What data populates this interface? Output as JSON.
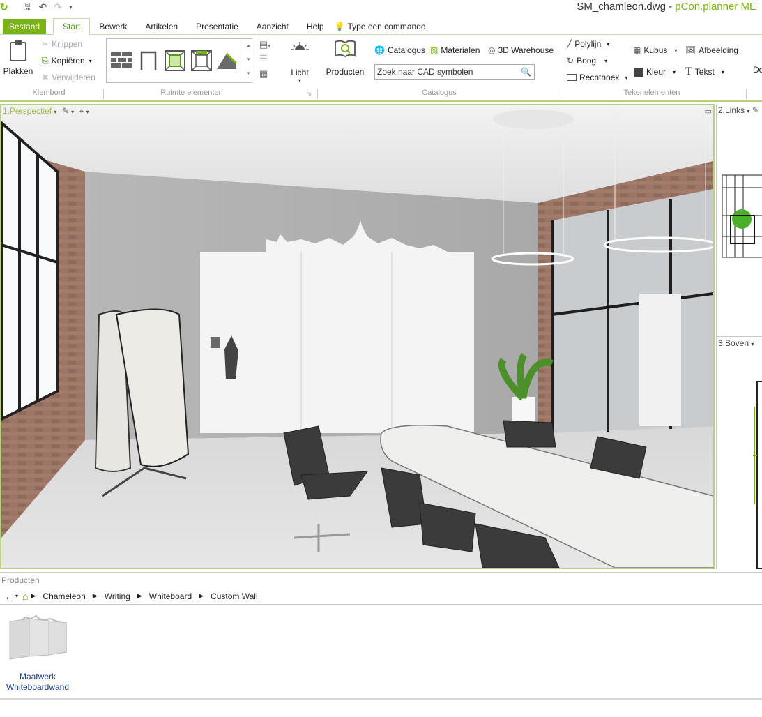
{
  "window": {
    "file_name": "SM_chamleon.dwg",
    "separator": " - ",
    "app_name": "pCon.planner ME"
  },
  "tabs": [
    {
      "label": "Bestand"
    },
    {
      "label": "Start"
    },
    {
      "label": "Bewerk"
    },
    {
      "label": "Artikelen"
    },
    {
      "label": "Presentatie"
    },
    {
      "label": "Aanzicht"
    },
    {
      "label": "Help"
    }
  ],
  "command_hint": "Type een commando",
  "ribbon": {
    "clipboard": {
      "paste": "Plakken",
      "cut": "Knippen",
      "copy": "Kopiëren",
      "delete": "Verwijderen",
      "group": "Klembord"
    },
    "room_elements": {
      "group": "Ruimte elementen"
    },
    "light": "Licht",
    "products": "Producten",
    "catalog": {
      "catalogus": "Catalogus",
      "materials": "Materialen",
      "warehouse": "3D Warehouse",
      "search_value": "Zoek naar CAD symbolen",
      "group": "Catalogus"
    },
    "drawing": {
      "polyline": "Polylijn",
      "arc": "Boog",
      "rectangle": "Rechthoek",
      "cube": "Kubus",
      "color": "Kleur",
      "image": "Afbeelding",
      "text": "Tekst",
      "cut_off": "Do",
      "group": "Tekenelementen"
    }
  },
  "viewports": {
    "main": "1.Perspectief",
    "left": "2.Links",
    "top": "3.Boven"
  },
  "products_panel": {
    "title": "Producten",
    "breadcrumb": [
      "Chameleon",
      "Writing",
      "Whiteboard",
      "Custom Wall"
    ],
    "items": [
      {
        "label_line1": "Maatwerk",
        "label_line2": "Whiteboardwand"
      }
    ]
  },
  "colors": {
    "accent": "#7ab317",
    "viewport_border": "#b7d27a",
    "link": "#1a3e8c"
  }
}
